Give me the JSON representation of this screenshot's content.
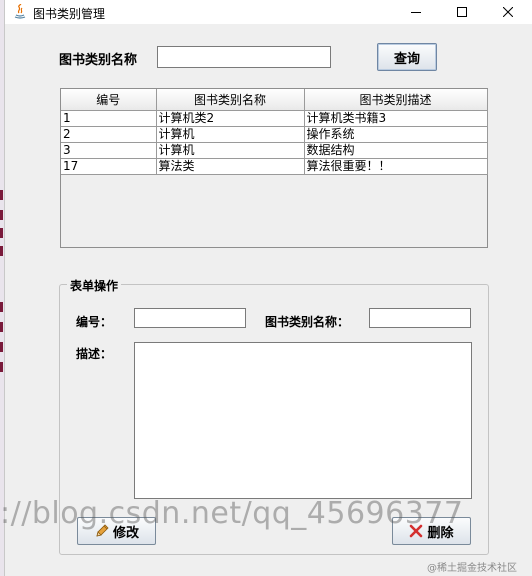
{
  "window": {
    "title": "图书类别管理"
  },
  "search": {
    "label": "图书类别名称",
    "value": "",
    "button_label": "查询"
  },
  "table": {
    "columns": [
      "编号",
      "图书类别名称",
      "图书类别描述"
    ],
    "rows": [
      [
        "1",
        "计算机类2",
        "计算机类书籍3"
      ],
      [
        "2",
        "计算机",
        "操作系统"
      ],
      [
        "3",
        "计算机",
        "数据结构"
      ],
      [
        "17",
        "算法类",
        "算法很重要！！"
      ]
    ]
  },
  "form": {
    "group_title": "表单操作",
    "id_label": "编号：",
    "id_value": "",
    "name_label": "图书类别名称：",
    "name_value": "",
    "desc_label": "描述：",
    "desc_value": "",
    "edit_button": "修改",
    "delete_button": "删除"
  },
  "overlay": {
    "watermark": "://blog.csdn.net/qq_45696377",
    "source_badge": "@稀土掘金技术社区"
  },
  "colors": {
    "window_bg": "#efefef",
    "delete_icon": "#d32f2f",
    "edit_icon": "#e6a23c"
  }
}
